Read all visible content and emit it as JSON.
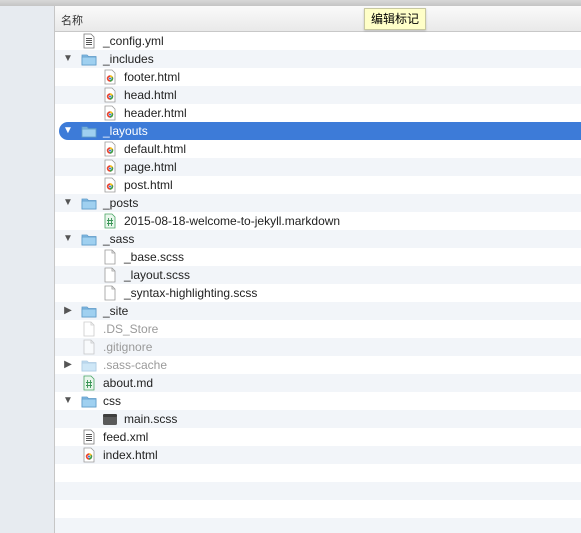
{
  "header": {
    "column_name": "名称"
  },
  "tooltip": {
    "text": "编辑标记"
  },
  "files": [
    {
      "name": "_config.yml",
      "type": "doc",
      "depth": 0,
      "expander": "none",
      "dim": false,
      "selected": false
    },
    {
      "name": "_includes",
      "type": "folder",
      "depth": 0,
      "expander": "open",
      "dim": false,
      "selected": false
    },
    {
      "name": "footer.html",
      "type": "html",
      "depth": 1,
      "expander": "none",
      "dim": false,
      "selected": false
    },
    {
      "name": "head.html",
      "type": "html",
      "depth": 1,
      "expander": "none",
      "dim": false,
      "selected": false
    },
    {
      "name": "header.html",
      "type": "html",
      "depth": 1,
      "expander": "none",
      "dim": false,
      "selected": false
    },
    {
      "name": "_layouts",
      "type": "folder",
      "depth": 0,
      "expander": "open",
      "dim": false,
      "selected": true
    },
    {
      "name": "default.html",
      "type": "html",
      "depth": 1,
      "expander": "none",
      "dim": false,
      "selected": false
    },
    {
      "name": "page.html",
      "type": "html",
      "depth": 1,
      "expander": "none",
      "dim": false,
      "selected": false
    },
    {
      "name": "post.html",
      "type": "html",
      "depth": 1,
      "expander": "none",
      "dim": false,
      "selected": false
    },
    {
      "name": "_posts",
      "type": "folder",
      "depth": 0,
      "expander": "open",
      "dim": false,
      "selected": false
    },
    {
      "name": "2015-08-18-welcome-to-jekyll.markdown",
      "type": "markdown",
      "depth": 1,
      "expander": "none",
      "dim": false,
      "selected": false
    },
    {
      "name": "_sass",
      "type": "folder",
      "depth": 0,
      "expander": "open",
      "dim": false,
      "selected": false
    },
    {
      "name": "_base.scss",
      "type": "blank",
      "depth": 1,
      "expander": "none",
      "dim": false,
      "selected": false
    },
    {
      "name": "_layout.scss",
      "type": "blank",
      "depth": 1,
      "expander": "none",
      "dim": false,
      "selected": false
    },
    {
      "name": "_syntax-highlighting.scss",
      "type": "blank",
      "depth": 1,
      "expander": "none",
      "dim": false,
      "selected": false
    },
    {
      "name": "_site",
      "type": "folder",
      "depth": 0,
      "expander": "closed",
      "dim": false,
      "selected": false
    },
    {
      "name": ".DS_Store",
      "type": "blank",
      "depth": 0,
      "expander": "none",
      "dim": true,
      "selected": false
    },
    {
      "name": ".gitignore",
      "type": "blank",
      "depth": 0,
      "expander": "none",
      "dim": true,
      "selected": false
    },
    {
      "name": ".sass-cache",
      "type": "folder",
      "depth": 0,
      "expander": "closed",
      "dim": true,
      "selected": false
    },
    {
      "name": "about.md",
      "type": "markdown",
      "depth": 0,
      "expander": "none",
      "dim": false,
      "selected": false
    },
    {
      "name": "css",
      "type": "folder",
      "depth": 0,
      "expander": "open",
      "dim": false,
      "selected": false
    },
    {
      "name": "main.scss",
      "type": "dark",
      "depth": 1,
      "expander": "none",
      "dim": false,
      "selected": false
    },
    {
      "name": "feed.xml",
      "type": "doc",
      "depth": 0,
      "expander": "none",
      "dim": false,
      "selected": false
    },
    {
      "name": "index.html",
      "type": "html",
      "depth": 0,
      "expander": "none",
      "dim": false,
      "selected": false
    }
  ],
  "colors": {
    "selection": "#3d7bd8",
    "folder": "#86bde6",
    "row_alt": "#f2f5f9",
    "sidebar": "#e7ebf0"
  }
}
